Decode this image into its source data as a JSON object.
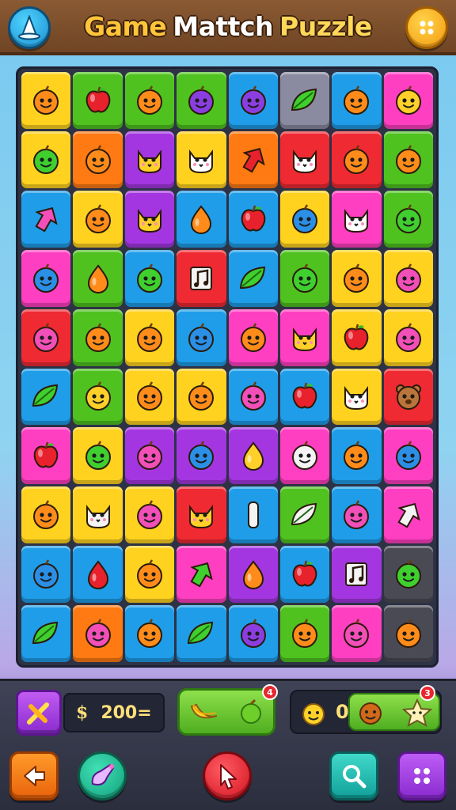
{
  "header": {
    "title_part1": "Game",
    "title_part2": "Mattch",
    "title_part3": "Puzzle",
    "left_icon": "wizard-hat-icon",
    "right_icon": "dots-menu-icon"
  },
  "board": {
    "rows": 10,
    "cols": 8,
    "palette": {
      "Y": "#ffd21f",
      "G": "#4fc21f",
      "R": "#ef2a33",
      "O": "#ff7a13",
      "B": "#1f9de8",
      "P": "#a336e0",
      "K": "#ff3fc1",
      "D": "#4a4a55",
      "GR": "#8a8aa0"
    },
    "icon_colors": {
      "orange": "#ff8c1a",
      "red": "#e8222c",
      "green": "#3fcf2f",
      "purple": "#8b3ee0",
      "blue": "#2b8fe6",
      "yellow": "#ffd02a",
      "pink": "#f24fb8",
      "white": "#ffffff",
      "brown": "#b9753b",
      "light": "#f4f4f4"
    },
    "grid": [
      [
        [
          "Y",
          "face",
          "orange"
        ],
        [
          "G",
          "apple",
          "red"
        ],
        [
          "G",
          "face",
          "orange"
        ],
        [
          "G",
          "face",
          "purple"
        ],
        [
          "B",
          "face",
          "purple"
        ],
        [
          "GR",
          "leaf",
          "green"
        ],
        [
          "B",
          "face",
          "orange"
        ],
        [
          "K",
          "face",
          "yellow"
        ]
      ],
      [
        [
          "Y",
          "face",
          "green"
        ],
        [
          "O",
          "face",
          "orange"
        ],
        [
          "P",
          "cat",
          "yellow"
        ],
        [
          "Y",
          "cat",
          "white"
        ],
        [
          "O",
          "arrow",
          "red"
        ],
        [
          "R",
          "cat",
          "white"
        ],
        [
          "R",
          "face",
          "orange"
        ],
        [
          "G",
          "face",
          "orange"
        ]
      ],
      [
        [
          "B",
          "arrow",
          "pink"
        ],
        [
          "Y",
          "face",
          "orange"
        ],
        [
          "P",
          "cat",
          "yellow"
        ],
        [
          "B",
          "drop",
          "orange"
        ],
        [
          "B",
          "apple",
          "red"
        ],
        [
          "Y",
          "face",
          "blue"
        ],
        [
          "K",
          "cat",
          "white"
        ],
        [
          "G",
          "face",
          "green"
        ]
      ],
      [
        [
          "K",
          "face",
          "blue"
        ],
        [
          "G",
          "drop",
          "orange"
        ],
        [
          "B",
          "face",
          "green"
        ],
        [
          "R",
          "note",
          "light"
        ],
        [
          "B",
          "leaf",
          "green"
        ],
        [
          "G",
          "face",
          "green"
        ],
        [
          "Y",
          "face",
          "orange"
        ],
        [
          "Y",
          "face",
          "pink"
        ]
      ],
      [
        [
          "R",
          "face",
          "pink"
        ],
        [
          "G",
          "face",
          "orange"
        ],
        [
          "Y",
          "face",
          "orange"
        ],
        [
          "B",
          "face",
          "blue"
        ],
        [
          "K",
          "face",
          "orange"
        ],
        [
          "K",
          "cat",
          "yellow"
        ],
        [
          "Y",
          "apple",
          "red"
        ],
        [
          "Y",
          "face",
          "pink"
        ]
      ],
      [
        [
          "B",
          "leaf",
          "green"
        ],
        [
          "G",
          "face",
          "yellow"
        ],
        [
          "Y",
          "face",
          "orange"
        ],
        [
          "Y",
          "face",
          "orange"
        ],
        [
          "B",
          "face",
          "pink"
        ],
        [
          "B",
          "apple",
          "red"
        ],
        [
          "Y",
          "cat",
          "white"
        ],
        [
          "R",
          "bear",
          "brown"
        ]
      ],
      [
        [
          "K",
          "apple",
          "red"
        ],
        [
          "Y",
          "face",
          "green"
        ],
        [
          "P",
          "face",
          "pink"
        ],
        [
          "P",
          "face",
          "blue"
        ],
        [
          "P",
          "drop",
          "yellow"
        ],
        [
          "K",
          "face",
          "light"
        ],
        [
          "B",
          "face",
          "orange"
        ],
        [
          "K",
          "face",
          "blue"
        ]
      ],
      [
        [
          "Y",
          "face",
          "orange"
        ],
        [
          "Y",
          "cat",
          "light"
        ],
        [
          "Y",
          "face",
          "pink"
        ],
        [
          "R",
          "cat",
          "yellow"
        ],
        [
          "B",
          "bar",
          "light"
        ],
        [
          "G",
          "leaf",
          "light"
        ],
        [
          "B",
          "face",
          "pink"
        ],
        [
          "K",
          "arrow",
          "light"
        ]
      ],
      [
        [
          "B",
          "face",
          "blue"
        ],
        [
          "B",
          "drop",
          "red"
        ],
        [
          "Y",
          "face",
          "orange"
        ],
        [
          "K",
          "arrow",
          "green"
        ],
        [
          "P",
          "drop",
          "orange"
        ],
        [
          "B",
          "apple",
          "red"
        ],
        [
          "P",
          "note",
          "light"
        ],
        [
          "D",
          "face",
          "green"
        ]
      ],
      [
        [
          "B",
          "leaf",
          "green"
        ],
        [
          "O",
          "face",
          "pink"
        ],
        [
          "B",
          "face",
          "orange"
        ],
        [
          "B",
          "leaf",
          "green"
        ],
        [
          "B",
          "face",
          "purple"
        ],
        [
          "G",
          "face",
          "orange"
        ],
        [
          "K",
          "face",
          "pink"
        ],
        [
          "D",
          "face",
          "orange"
        ]
      ]
    ]
  },
  "bottom": {
    "boost_icon": "crossed-swords-icon",
    "currency_symbol": "$",
    "score_value": "200=",
    "fruit_badge": "4",
    "right_count": "0",
    "right_badge": "3"
  },
  "buttons": {
    "back_icon": "arrow-left-icon",
    "hint_icon": "potion-icon",
    "play_icon": "cursor-icon",
    "search_icon": "search-icon",
    "menu_icon": "grid-menu-icon"
  }
}
